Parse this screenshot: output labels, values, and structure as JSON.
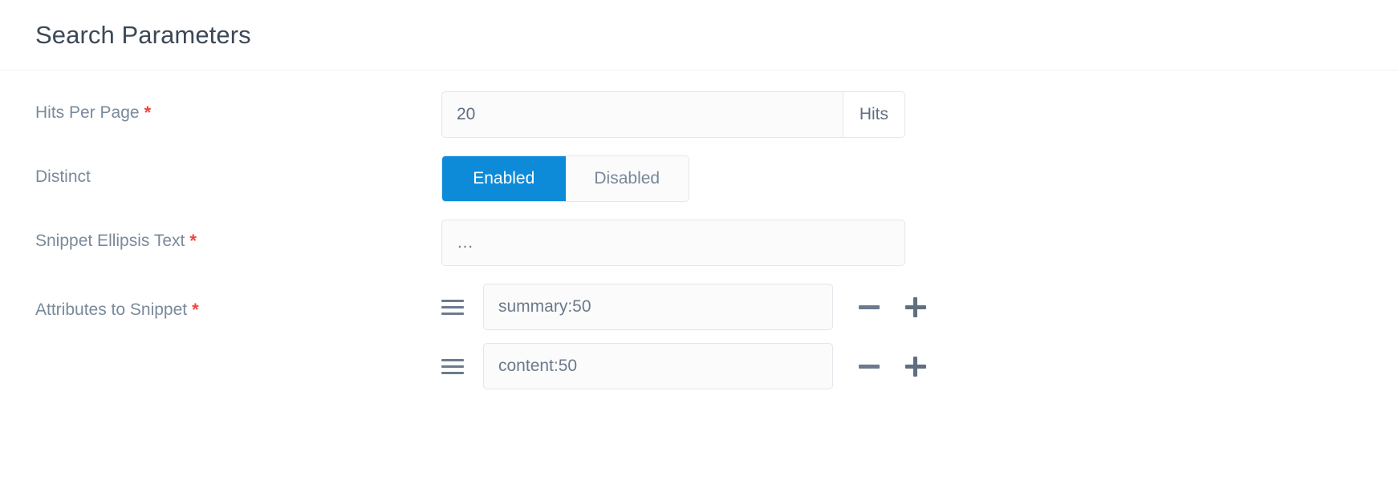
{
  "header": {
    "title": "Search Parameters"
  },
  "required_marker": "*",
  "colors": {
    "accent_blue": "#0d8bd9",
    "required_red": "#e8473f",
    "label_gray": "#7a8a9a",
    "title_gray": "#3c4858",
    "field_border": "#e3e6ea",
    "field_bg": "#fbfbfc"
  },
  "fields": {
    "hits_per_page": {
      "label": "Hits Per Page",
      "required": true,
      "value": "20",
      "addon": "Hits"
    },
    "distinct": {
      "label": "Distinct",
      "required": false,
      "selected": "Enabled",
      "options": [
        {
          "label": "Enabled",
          "active": true
        },
        {
          "label": "Disabled",
          "active": false
        }
      ]
    },
    "snippet_ellipsis_text": {
      "label": "Snippet Ellipsis Text",
      "required": true,
      "value": "…",
      "placeholder": "…"
    },
    "attributes_to_snippet": {
      "label": "Attributes to Snippet",
      "required": true,
      "items": [
        {
          "value": "summary:50"
        },
        {
          "value": "content:50"
        }
      ],
      "icons": {
        "drag": "drag-handle-icon",
        "remove": "minus-icon",
        "add": "plus-icon"
      }
    }
  }
}
